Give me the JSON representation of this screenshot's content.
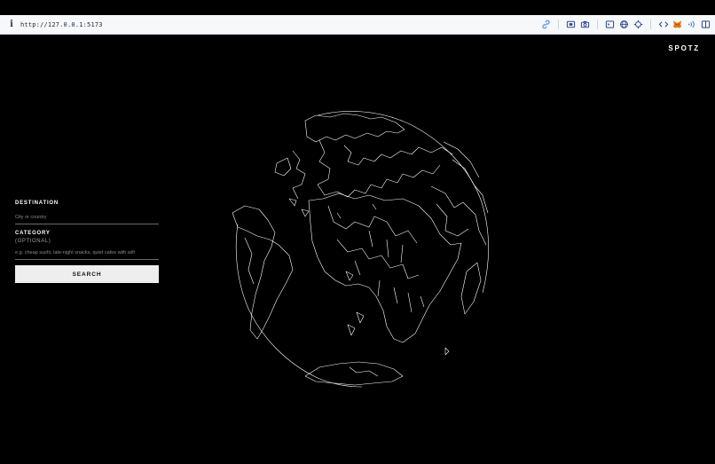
{
  "browser": {
    "url": "http://127.0.0.1:5173",
    "toolbar_icons": [
      "link-icon",
      "screenshot-icon",
      "camera-icon",
      "terminal-icon",
      "globe-icon",
      "crosshair-icon",
      "code-icon",
      "metamask-fox-icon",
      "audio-icon",
      "sidebar-icon"
    ]
  },
  "app": {
    "brand": "SPOTZ",
    "destination_label": "DESTINATION",
    "destination_placeholder": "City or country",
    "category_label": "CATEGORY",
    "category_optional": "(OPTIONAL)",
    "category_placeholder": "e.g. cheap sushi, late-night snacks, quiet cafes with wifi",
    "search_button": "SEARCH"
  },
  "colors": {
    "background": "#000000",
    "text": "#ffffff",
    "button_bg": "#eeeeee",
    "urlbar_bg": "#f7f8fa",
    "globe_lines": "#ffffff",
    "metamask_orange": "#e2761b"
  }
}
